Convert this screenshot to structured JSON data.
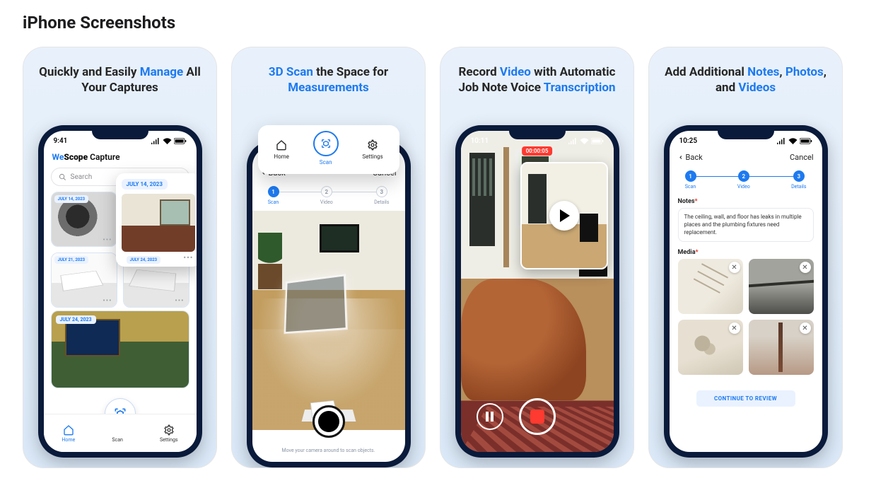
{
  "section_title": "iPhone Screenshots",
  "captions": {
    "s1_a": "Quickly and Easily ",
    "s1_hl": "Manage",
    "s1_b": " All Your Captures",
    "s2_hl": "3D Scan",
    "s2_b": " the Space for ",
    "s2_hl2": "Measurements",
    "s3_a": "Record ",
    "s3_hl": "Video",
    "s3_b": " with Automatic Job Note Voice ",
    "s3_hl2": "Transcription",
    "s4_a": "Add Additional ",
    "s4_hl": "Notes",
    "s4_b": ", ",
    "s4_hl2": "Photos",
    "s4_c": ", and ",
    "s4_hl3": "Videos"
  },
  "status_times": {
    "s1": "9:41",
    "s2": "",
    "s3": "10:11",
    "s4": "10:25"
  },
  "nav": {
    "back": "Back",
    "cancel": "Cancel"
  },
  "steps": {
    "l1": "Scan",
    "l2": "Video",
    "l3": "Details"
  },
  "shot1": {
    "app_we": "We",
    "app_scope": "Scope ",
    "app_capture": "Capture",
    "search_placeholder": "Search",
    "overlay_date": "JULY 14, 2023",
    "cards": [
      "JULY 14, 2023",
      "JULY 21, 2023",
      "JULY 24, 2023",
      "JULY 24, 2023"
    ],
    "tabs": {
      "home": "Home",
      "scan": "Scan",
      "settings": "Settings"
    }
  },
  "shot2": {
    "menu": {
      "home": "Home",
      "scan": "Scan",
      "settings": "Settings"
    },
    "hint": "Move your camera around to scan objects."
  },
  "shot3": {
    "rec_time": "00:00:05"
  },
  "shot4": {
    "notes_label": "Notes",
    "media_label": "Media",
    "req": "*",
    "note_text": "The ceiling, wall, and floor has leaks in multiple places and the plumbing fixtures need replacement.",
    "cta": "CONTINUE TO REVIEW"
  }
}
